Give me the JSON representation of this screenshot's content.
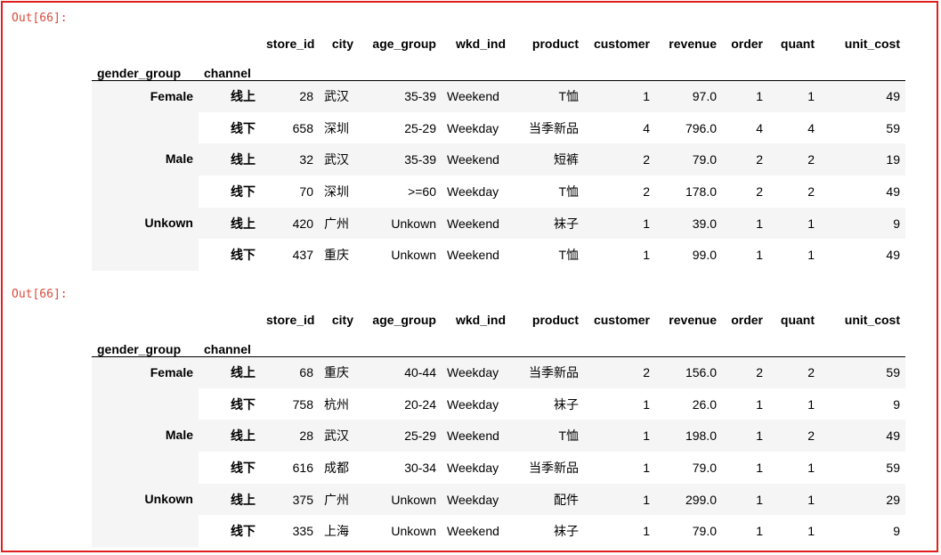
{
  "colors": {
    "frame": "#e0201f",
    "prompt": "#d84a3a",
    "stripe": "#f5f5f5"
  },
  "outputs": [
    {
      "prompt": "Out[66]:",
      "columns": [
        "store_id",
        "city",
        "age_group",
        "wkd_ind",
        "product",
        "customer",
        "revenue",
        "order",
        "quant",
        "unit_cost"
      ],
      "index_names": [
        "gender_group",
        "channel"
      ],
      "rows": [
        {
          "gender": "Female",
          "channel": "线上",
          "store_id": "28",
          "city": "武汉",
          "age_group": "35-39",
          "wkd_ind": "Weekend",
          "product": "T恤",
          "customer": "1",
          "revenue": "97.0",
          "order": "1",
          "quant": "1",
          "unit_cost": "49"
        },
        {
          "gender": "",
          "channel": "线下",
          "store_id": "658",
          "city": "深圳",
          "age_group": "25-29",
          "wkd_ind": "Weekday",
          "product": "当季新品",
          "customer": "4",
          "revenue": "796.0",
          "order": "4",
          "quant": "4",
          "unit_cost": "59"
        },
        {
          "gender": "Male",
          "channel": "线上",
          "store_id": "32",
          "city": "武汉",
          "age_group": "35-39",
          "wkd_ind": "Weekend",
          "product": "短裤",
          "customer": "2",
          "revenue": "79.0",
          "order": "2",
          "quant": "2",
          "unit_cost": "19"
        },
        {
          "gender": "",
          "channel": "线下",
          "store_id": "70",
          "city": "深圳",
          "age_group": ">=60",
          "wkd_ind": "Weekday",
          "product": "T恤",
          "customer": "2",
          "revenue": "178.0",
          "order": "2",
          "quant": "2",
          "unit_cost": "49"
        },
        {
          "gender": "Unkown",
          "channel": "线上",
          "store_id": "420",
          "city": "广州",
          "age_group": "Unkown",
          "wkd_ind": "Weekend",
          "product": "袜子",
          "customer": "1",
          "revenue": "39.0",
          "order": "1",
          "quant": "1",
          "unit_cost": "9"
        },
        {
          "gender": "",
          "channel": "线下",
          "store_id": "437",
          "city": "重庆",
          "age_group": "Unkown",
          "wkd_ind": "Weekend",
          "product": "T恤",
          "customer": "1",
          "revenue": "99.0",
          "order": "1",
          "quant": "1",
          "unit_cost": "49"
        }
      ]
    },
    {
      "prompt": "Out[66]:",
      "columns": [
        "store_id",
        "city",
        "age_group",
        "wkd_ind",
        "product",
        "customer",
        "revenue",
        "order",
        "quant",
        "unit_cost"
      ],
      "index_names": [
        "gender_group",
        "channel"
      ],
      "rows": [
        {
          "gender": "Female",
          "channel": "线上",
          "store_id": "68",
          "city": "重庆",
          "age_group": "40-44",
          "wkd_ind": "Weekday",
          "product": "当季新品",
          "customer": "2",
          "revenue": "156.0",
          "order": "2",
          "quant": "2",
          "unit_cost": "59"
        },
        {
          "gender": "",
          "channel": "线下",
          "store_id": "758",
          "city": "杭州",
          "age_group": "20-24",
          "wkd_ind": "Weekday",
          "product": "袜子",
          "customer": "1",
          "revenue": "26.0",
          "order": "1",
          "quant": "1",
          "unit_cost": "9"
        },
        {
          "gender": "Male",
          "channel": "线上",
          "store_id": "28",
          "city": "武汉",
          "age_group": "25-29",
          "wkd_ind": "Weekend",
          "product": "T恤",
          "customer": "1",
          "revenue": "198.0",
          "order": "1",
          "quant": "2",
          "unit_cost": "49"
        },
        {
          "gender": "",
          "channel": "线下",
          "store_id": "616",
          "city": "成都",
          "age_group": "30-34",
          "wkd_ind": "Weekday",
          "product": "当季新品",
          "customer": "1",
          "revenue": "79.0",
          "order": "1",
          "quant": "1",
          "unit_cost": "59"
        },
        {
          "gender": "Unkown",
          "channel": "线上",
          "store_id": "375",
          "city": "广州",
          "age_group": "Unkown",
          "wkd_ind": "Weekday",
          "product": "配件",
          "customer": "1",
          "revenue": "299.0",
          "order": "1",
          "quant": "1",
          "unit_cost": "29"
        },
        {
          "gender": "",
          "channel": "线下",
          "store_id": "335",
          "city": "上海",
          "age_group": "Unkown",
          "wkd_ind": "Weekend",
          "product": "袜子",
          "customer": "1",
          "revenue": "79.0",
          "order": "1",
          "quant": "1",
          "unit_cost": "9"
        }
      ]
    }
  ]
}
